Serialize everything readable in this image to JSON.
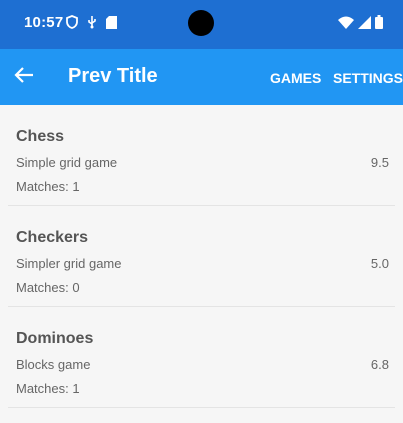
{
  "status_bar": {
    "time": "10:57",
    "left_icons": [
      "shield-icon",
      "usb-icon",
      "sd-card-icon"
    ],
    "right_icons": [
      "wifi-icon",
      "signal-icon",
      "battery-icon"
    ]
  },
  "app_bar": {
    "title": "Prev Title",
    "actions": [
      "GAMES",
      "SETTINGS"
    ],
    "color": "#2196f3"
  },
  "games": [
    {
      "name": "Chess",
      "description": "Simple grid game",
      "rating": "9.5",
      "matches": "Matches: 1"
    },
    {
      "name": "Checkers",
      "description": "Simpler grid game",
      "rating": "5.0",
      "matches": "Matches: 0"
    },
    {
      "name": "Dominoes",
      "description": "Blocks game",
      "rating": "6.8",
      "matches": "Matches: 1"
    }
  ]
}
